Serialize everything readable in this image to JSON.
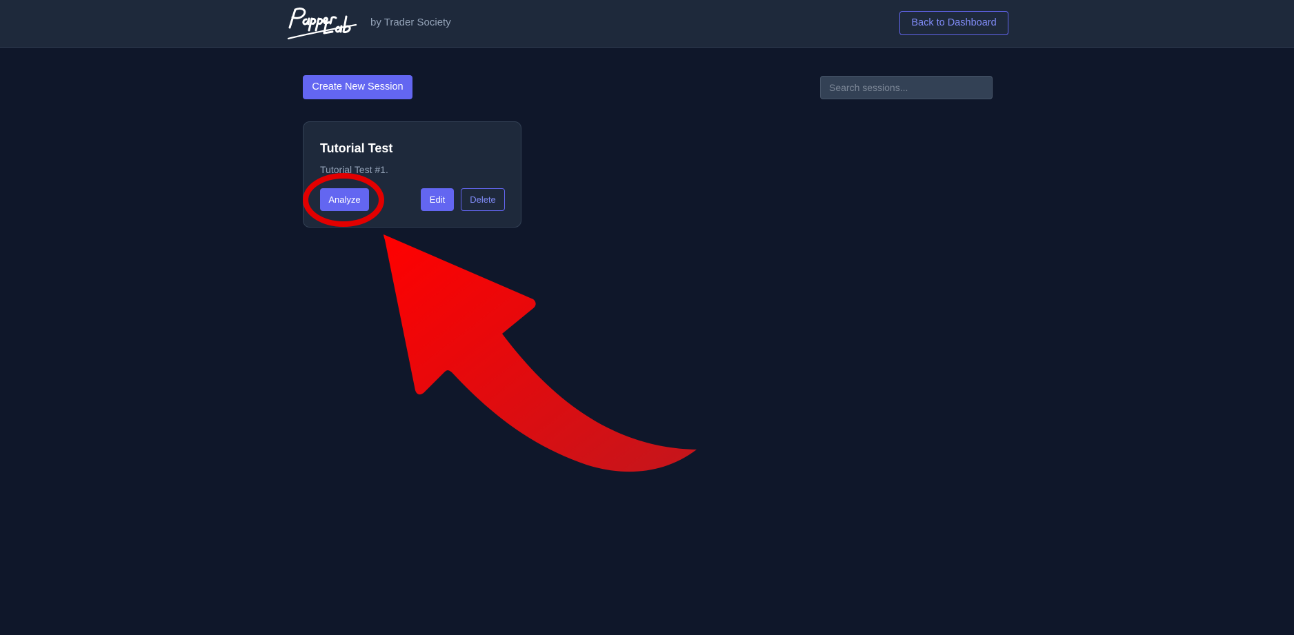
{
  "header": {
    "logo_text": "Paper Lab",
    "byline": "by Trader Society",
    "back_button": "Back to Dashboard"
  },
  "toolbar": {
    "create_button": "Create New Session",
    "search_placeholder": "Search sessions...",
    "search_value": ""
  },
  "sessions": [
    {
      "title": "Tutorial Test",
      "description": "Tutorial Test #1.",
      "analyze_label": "Analyze",
      "edit_label": "Edit",
      "delete_label": "Delete"
    }
  ],
  "annotation": {
    "color": "#e30000",
    "icons": [
      "highlight-circle",
      "curved-arrow"
    ]
  },
  "colors": {
    "background": "#0f172a",
    "surface": "#1e293b",
    "accent": "#6366f1"
  }
}
